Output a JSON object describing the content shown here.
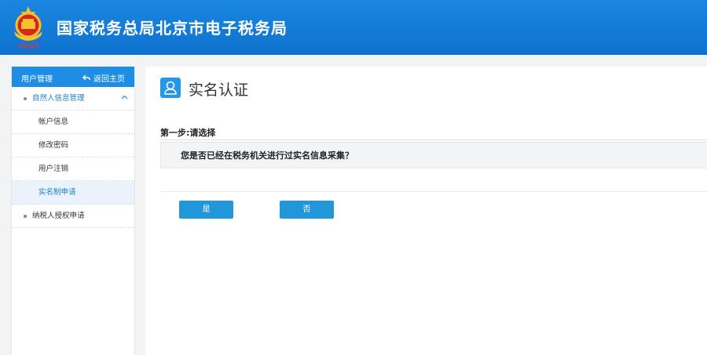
{
  "header": {
    "title": "国家税务总局北京市电子税务局",
    "logo_icon": "tax-emblem-icon",
    "logo_text": "中国税务"
  },
  "sidebar": {
    "header_title": "用户管理",
    "back_label": "返回主页",
    "back_icon": "return-arrow-icon",
    "items": [
      {
        "label": "自然人信息管理",
        "type": "group",
        "expanded": true
      },
      {
        "label": "帐户信息",
        "type": "sub"
      },
      {
        "label": "修改密码",
        "type": "sub"
      },
      {
        "label": "用户注销",
        "type": "sub"
      },
      {
        "label": "实名制申请",
        "type": "sub",
        "active": true
      },
      {
        "label": "纳税人授权申请",
        "type": "group"
      }
    ]
  },
  "main": {
    "title": "实名认证",
    "title_icon": "user-icon",
    "step_label": "第一步:请选择",
    "question": "您是否已经在税务机关进行过实名信息采集？",
    "yes_label": "是",
    "no_label": "否"
  },
  "colors": {
    "header_bg": "#1a86e0",
    "accent": "#1d8ee4",
    "button": "#2196d8",
    "active_bg": "#eaf3fc",
    "active_text": "#1b7cc8"
  }
}
